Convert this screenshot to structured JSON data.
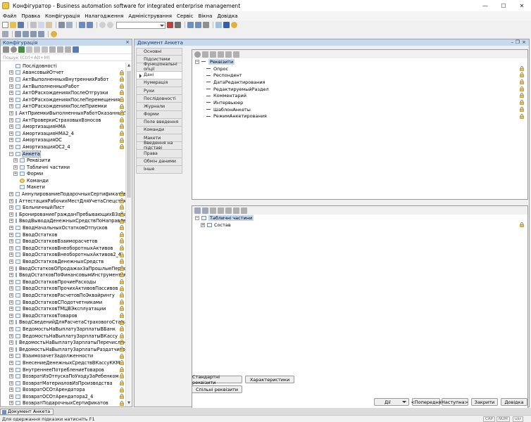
{
  "window": {
    "title": "Конфігуратор - Business automation software for integrated enterprise management",
    "minimize": "—",
    "maximize": "☐",
    "close": "✕"
  },
  "menu": [
    "Файл",
    "Правка",
    "Конфігурація",
    "Налагодження",
    "Адміністрування",
    "Сервіс",
    "Вікна",
    "Довідка"
  ],
  "config_panel": {
    "title": "Конфігурація",
    "search_placeholder": "Пошук (Ctrl+Alt+M)",
    "tree": [
      {
        "label": "Послідовності",
        "indent": 0,
        "expander": "",
        "lock": false,
        "icon": "sequence-icon"
      },
      {
        "label": "АвансовыйОтчет",
        "indent": 0,
        "expander": "+",
        "lock": true
      },
      {
        "label": "АктВыполненныхВнутреннихРабот",
        "indent": 0,
        "expander": "+",
        "lock": true
      },
      {
        "label": "АктВыполненныхРабот",
        "indent": 0,
        "expander": "+",
        "lock": true
      },
      {
        "label": "АктОРасхожденияхПослеОтгрузки",
        "indent": 0,
        "expander": "+",
        "lock": true
      },
      {
        "label": "АктОРасхожденияхПослеПеремещения",
        "indent": 0,
        "expander": "+",
        "lock": true
      },
      {
        "label": "АктОРасхожденияхПослеПриемки",
        "indent": 0,
        "expander": "+",
        "lock": true
      },
      {
        "label": "АктПриемкиВыполненныхРаботОказанныхУслуг",
        "indent": 0,
        "expander": "+",
        "lock": true
      },
      {
        "label": "АктПроверкиСтраховыхВзносов",
        "indent": 0,
        "expander": "+",
        "lock": true
      },
      {
        "label": "АмортизацияНМА",
        "indent": 0,
        "expander": "+",
        "lock": true
      },
      {
        "label": "АмортизацияНМА2_4",
        "indent": 0,
        "expander": "+",
        "lock": true
      },
      {
        "label": "АмортизацияОС",
        "indent": 0,
        "expander": "+",
        "lock": true
      },
      {
        "label": "АмортизацияОС2_4",
        "indent": 0,
        "expander": "+",
        "lock": true
      },
      {
        "label": "Анкета",
        "indent": 0,
        "expander": "−",
        "lock": false,
        "selected": true
      },
      {
        "label": "Реквізити",
        "indent": 1,
        "expander": "+",
        "lock": false,
        "icon": "attributes-icon"
      },
      {
        "label": "Табличні частини",
        "indent": 1,
        "expander": "+",
        "lock": false,
        "icon": "table-icon"
      },
      {
        "label": "Форми",
        "indent": 1,
        "expander": "+",
        "lock": false,
        "icon": "form-icon"
      },
      {
        "label": "Команди",
        "indent": 1,
        "expander": "",
        "lock": false,
        "icon": "command-icon"
      },
      {
        "label": "Макети",
        "indent": 1,
        "expander": "",
        "lock": false,
        "icon": "template-icon"
      },
      {
        "label": "АннулированиеПодарочныхСертификатов",
        "indent": 0,
        "expander": "+",
        "lock": true
      },
      {
        "label": "АттестацияРабочихМестДляУчетаСпецстажа",
        "indent": 0,
        "expander": "+",
        "lock": true
      },
      {
        "label": "БольничныйЛист",
        "indent": 0,
        "expander": "+",
        "lock": true
      },
      {
        "label": "БронированиеГражданПребывающихВЗапасе",
        "indent": 0,
        "expander": "+",
        "lock": true
      },
      {
        "label": "ВводВыводаДенежныхСредствПоНаправлению",
        "indent": 0,
        "expander": "+",
        "lock": true
      },
      {
        "label": "ВводНачальныхОстатковОтпусков",
        "indent": 0,
        "expander": "+",
        "lock": true
      },
      {
        "label": "ВводОстатков",
        "indent": 0,
        "expander": "+",
        "lock": true
      },
      {
        "label": "ВводОстатковВзаиморасчетов",
        "indent": 0,
        "expander": "+",
        "lock": true
      },
      {
        "label": "ВводОстатковВнеоборотныхАктивов",
        "indent": 0,
        "expander": "+",
        "lock": true
      },
      {
        "label": "ВводОстатковВнеоборотныхАктивов2_4",
        "indent": 0,
        "expander": "+",
        "lock": true
      },
      {
        "label": "ВводОстатковДенежныхСредств",
        "indent": 0,
        "expander": "+",
        "lock": true
      },
      {
        "label": "ВводОстатковОПродажахЗаПрошлыеПериоды",
        "indent": 0,
        "expander": "+",
        "lock": true
      },
      {
        "label": "ВводОстатковПоФинансовымИнструментам",
        "indent": 0,
        "expander": "+",
        "lock": true
      },
      {
        "label": "ВводОстатковПрочиеРасходы",
        "indent": 0,
        "expander": "+",
        "lock": true
      },
      {
        "label": "ВводОстатковПрочихАктивовПассивов",
        "indent": 0,
        "expander": "+",
        "lock": true
      },
      {
        "label": "ВводОстатковРасчетовПоЭквайрингу",
        "indent": 0,
        "expander": "+",
        "lock": true
      },
      {
        "label": "ВводОстатковСПодотчетниками",
        "indent": 0,
        "expander": "+",
        "lock": true
      },
      {
        "label": "ВводОстатковТМЦВЭксплуатации",
        "indent": 0,
        "expander": "+",
        "lock": true
      },
      {
        "label": "ВводОстатковТоваров",
        "indent": 0,
        "expander": "+",
        "lock": true
      },
      {
        "label": "ВводСведенийДляРасчетаСтраховогоСтажа",
        "indent": 0,
        "expander": "+",
        "lock": true
      },
      {
        "label": "ВедомостьНаВыплатуЗарплатыВБанк",
        "indent": 0,
        "expander": "+",
        "lock": true
      },
      {
        "label": "ВедомостьНаВыплатуЗарплатыВКассу",
        "indent": 0,
        "expander": "+",
        "lock": true
      },
      {
        "label": "ВедомостьНаВыплатуЗарплатыПеречислением",
        "indent": 0,
        "expander": "+",
        "lock": true
      },
      {
        "label": "ВедомостьНаВыплатуЗарплатыРаздатчиком",
        "indent": 0,
        "expander": "+",
        "lock": true
      },
      {
        "label": "ВзаимозачетЗадолженности",
        "indent": 0,
        "expander": "+",
        "lock": true
      },
      {
        "label": "ВнесениеДенежныхСредствВКассуККМ",
        "indent": 0,
        "expander": "+",
        "lock": true
      },
      {
        "label": "ВнутреннееПотреблениеТоваров",
        "indent": 0,
        "expander": "+",
        "lock": true
      },
      {
        "label": "ВозвратИзОтпускаПоУходуЗаРебенком",
        "indent": 0,
        "expander": "+",
        "lock": true
      },
      {
        "label": "ВозвратМатериаловИзПроизводства",
        "indent": 0,
        "expander": "+",
        "lock": true
      },
      {
        "label": "ВозвратОСОтАрендатора",
        "indent": 0,
        "expander": "+",
        "lock": true
      },
      {
        "label": "ВозвратОСОтАрендатора2_4",
        "indent": 0,
        "expander": "+",
        "lock": true
      },
      {
        "label": "ВозвратПодарочныхСертификатов",
        "indent": 0,
        "expander": "+",
        "lock": true
      }
    ]
  },
  "doc_window": {
    "title": "Документ Анкета",
    "tabs": [
      "Основні",
      "Підсистеми",
      "Функціональні опції",
      "Дані",
      "Нумерація",
      "Рухи",
      "Послідовності",
      "Журнали",
      "Форми",
      "Поле введення",
      "Команди",
      "Макети",
      "Введення на підставі",
      "Права",
      "Обмін даними",
      "Інше"
    ],
    "active_tab": "Дані",
    "attributes": {
      "root": "Реквізити",
      "items": [
        "Опрос",
        "Респондент",
        "ДатаРедактирования",
        "РедактируемыйРаздел",
        "Комментарий",
        "Интервьюер",
        "ШаблонАнкеты",
        "РежимАнкетирования"
      ]
    },
    "tabular_sections": {
      "root": "Табличні частини",
      "items": [
        "Состав"
      ]
    },
    "buttons": {
      "standard_attributes": "Стандартні реквізити",
      "characteristics": "Характеристики",
      "common_attributes": "Спільні реквізити",
      "actions": "Дії",
      "previous": "<Попередня",
      "next": "Наступна>",
      "close": "Закрити",
      "help": "Довідка"
    }
  },
  "taskbar": {
    "task": "Документ Анкета"
  },
  "status": {
    "hint": "Для одержання підказки натисніть F1",
    "caps": "CAP",
    "num": "NUM",
    "lang": "ukr"
  }
}
